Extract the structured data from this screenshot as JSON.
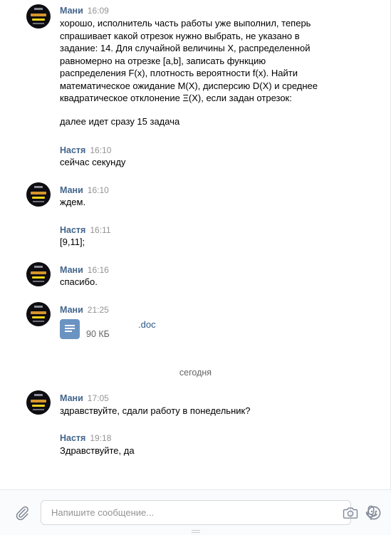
{
  "messages": [
    {
      "sender": "Мани",
      "time": "16:09",
      "has_avatar": true,
      "lines": [
        "хорошо, исполнитель часть работы уже выполнил, теперь",
        "спрашивает какой отрезок нужно выбрать, не указано в",
        "задание: 14. Для случайной величины X, распределенной",
        "равномерно на отрезке [a,b], записать функцию",
        "распределения F(x), плотность вероятности f(x). Найти",
        "математическое ожидание M(X), дисперсию D(X) и среднее",
        "квадратическое отклонение Ξ(X), если задан отрезок:"
      ],
      "extra": "далее идет сразу 15 задача"
    },
    {
      "sender": "Настя",
      "time": "16:10",
      "has_avatar": false,
      "text": "сейчас секунду"
    },
    {
      "sender": "Мани",
      "time": "16:10",
      "has_avatar": true,
      "text": "ждем."
    },
    {
      "sender": "Настя",
      "time": "16:11",
      "has_avatar": false,
      "text": "[9,11];"
    },
    {
      "sender": "Мани",
      "time": "16:16",
      "has_avatar": true,
      "text": "спасибо."
    },
    {
      "sender": "Мани",
      "time": "21:25",
      "has_avatar": true,
      "attachment": {
        "name": ".doc",
        "size": "90 КБ",
        "icon": "document-icon"
      }
    },
    {
      "sender": "Мани",
      "time": "17:05",
      "has_avatar": true,
      "text": "здравствуйте, сдали работу в понедельник?"
    },
    {
      "sender": "Настя",
      "time": "19:18",
      "has_avatar": false,
      "text": "Здравствуйте, да"
    }
  ],
  "date_divider": "сегодня",
  "composer": {
    "placeholder": "Напишите сообщение...",
    "icons": [
      "paperclip-icon",
      "camera-icon",
      "smile-icon",
      "microphone-icon"
    ]
  },
  "colors": {
    "sender_name": "#42648b",
    "link": "#2a5885",
    "doc_icon": "#5181b8",
    "meta": "#939393"
  }
}
